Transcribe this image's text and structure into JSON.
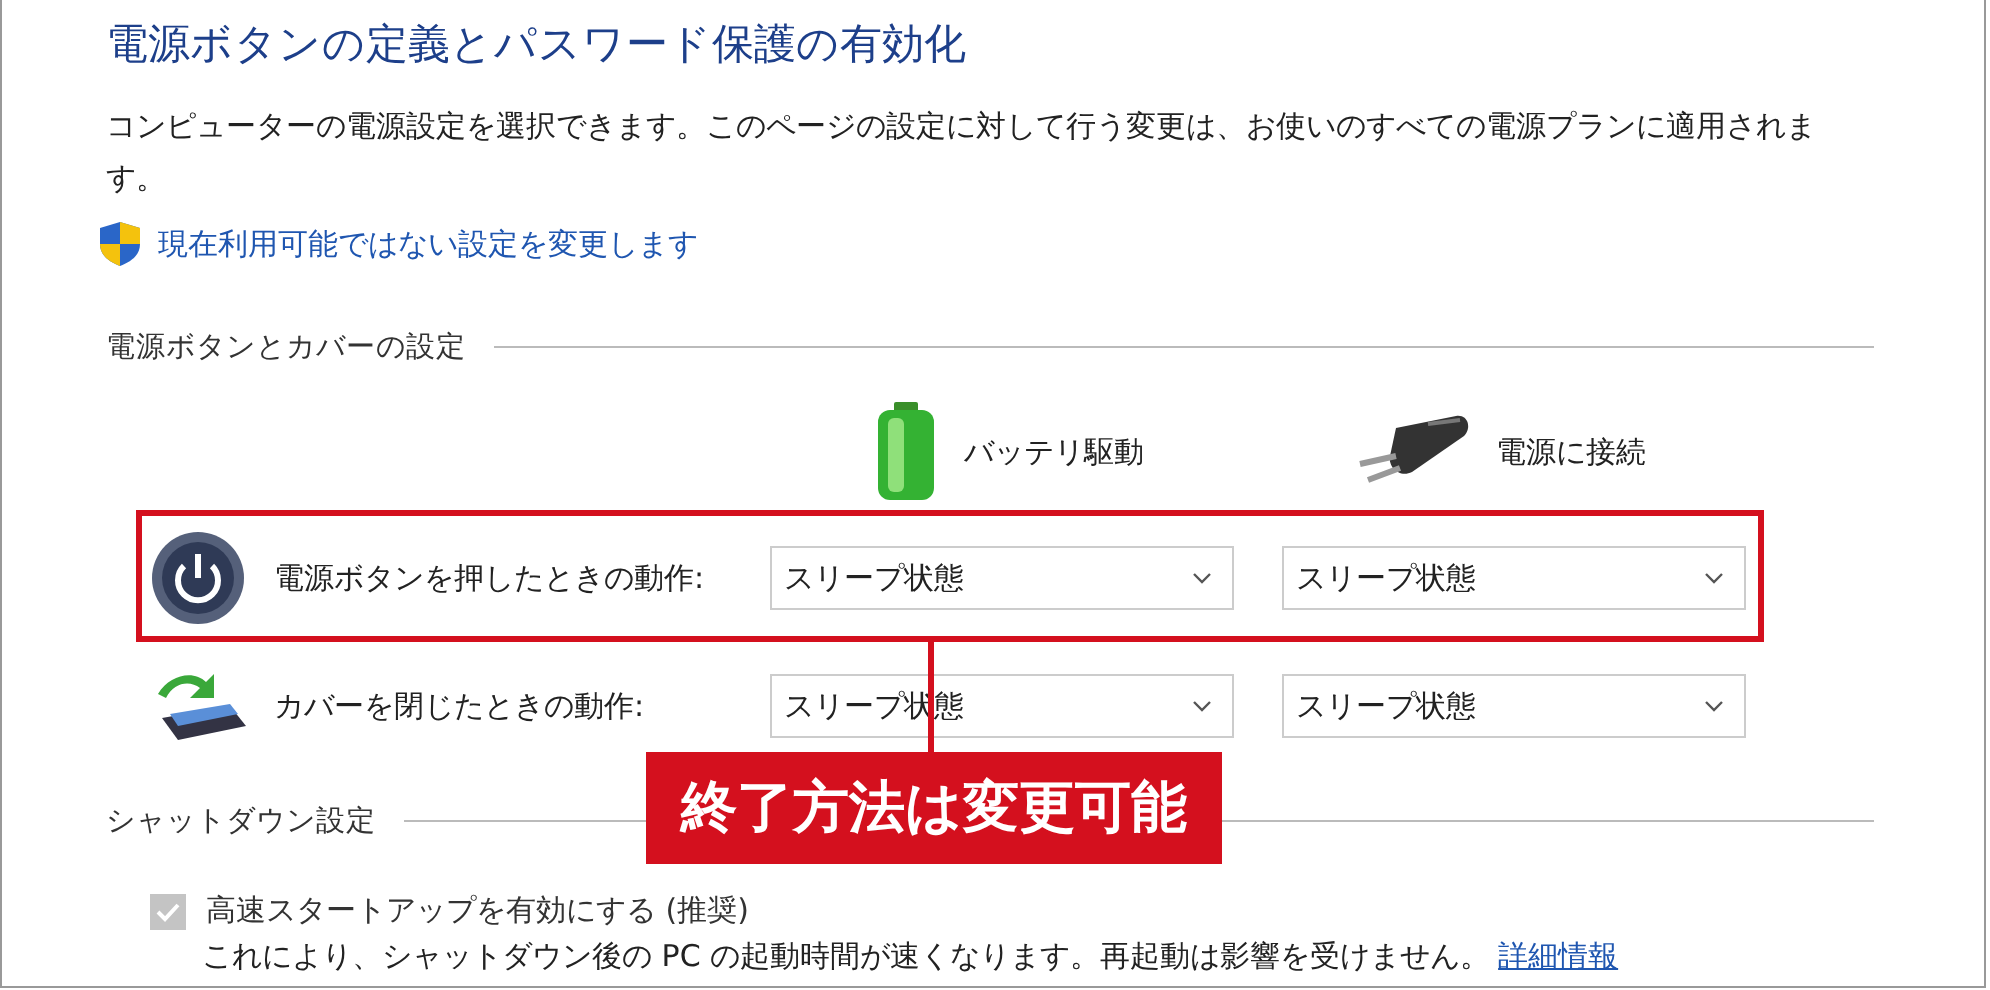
{
  "page": {
    "title": "電源ボタンの定義とパスワード保護の有効化",
    "description": "コンピューターの電源設定を選択できます。このページの設定に対して行う変更は、お使いのすべての電源プランに適用されます。",
    "admin_link": "現在利用可能ではない設定を変更します"
  },
  "button_settings": {
    "heading": "電源ボタンとカバーの設定",
    "columns": [
      {
        "label": "バッテリ駆動",
        "kind": "battery"
      },
      {
        "label": "電源に接続",
        "kind": "plug"
      }
    ],
    "rows": [
      {
        "label": "電源ボタンを押したときの動作:",
        "kind": "power",
        "values": [
          "スリープ状態",
          "スリープ状態"
        ]
      },
      {
        "label": "カバーを閉じたときの動作:",
        "kind": "lid",
        "values": [
          "スリープ状態",
          "スリープ状態"
        ]
      }
    ]
  },
  "shutdown_settings": {
    "heading": "シャットダウン設定",
    "options": [
      {
        "label": "高速スタートアップを有効にする (推奨)",
        "checked": true,
        "disabled": true,
        "description": "これにより、シャットダウン後の PC の起動時間が速くなります。再起動は影響を受けません。",
        "link": "詳細情報"
      }
    ]
  },
  "annotation": {
    "text": "終了方法は変更可能"
  }
}
